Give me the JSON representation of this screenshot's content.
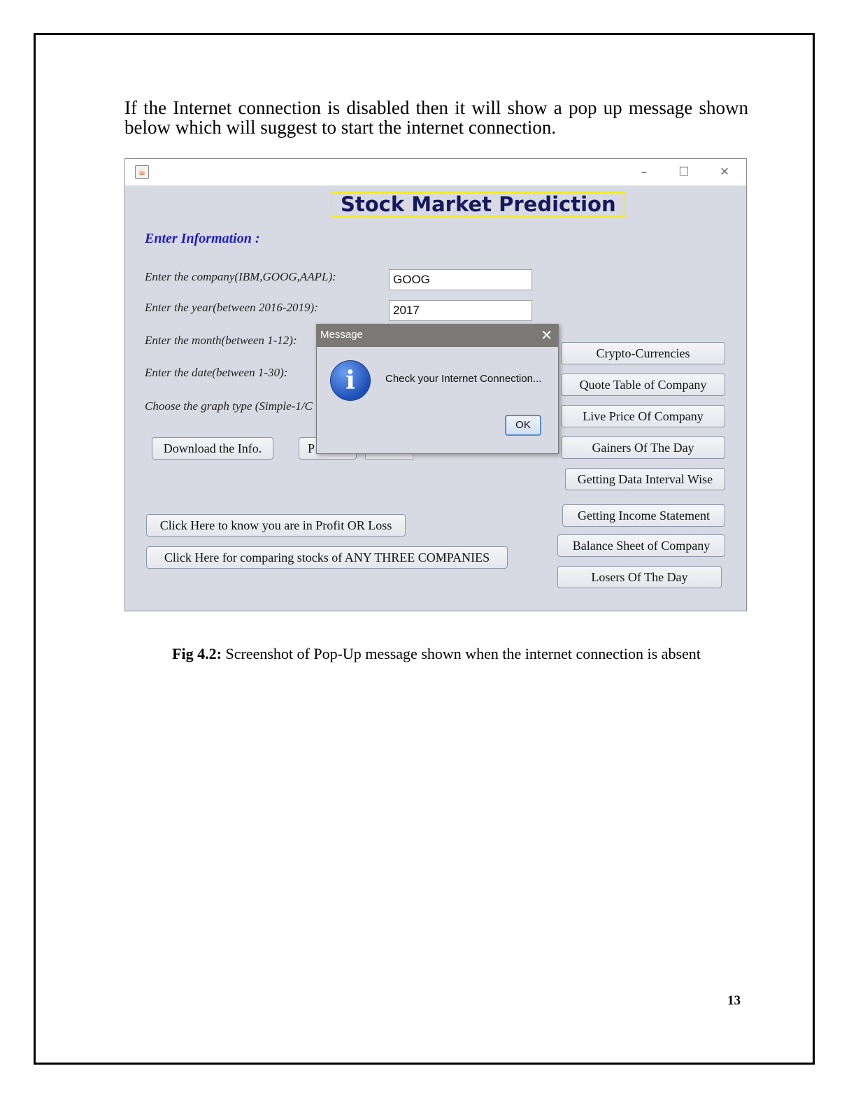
{
  "intro_text": "If the Internet connection is disabled then it will show a pop up message shown below which will suggest to start the internet connection.",
  "caption": {
    "label": "Fig 4.2:",
    "text": " Screenshot of Pop-Up message shown when the internet connection is absent"
  },
  "page_number": "13",
  "window": {
    "minimize": "–",
    "maximize": "☐",
    "close": "✕",
    "app_title": "Stock Market Prediction",
    "section_label": "Enter Information :",
    "fields": {
      "company_label": "Enter the company(IBM,GOOG,AAPL):",
      "company_value": "GOOG",
      "year_label": "Enter the year(between 2016-2019):",
      "year_value": "2017",
      "month_label": "Enter the month(between 1-12):",
      "date_label": "Enter the date(between 1-30):",
      "graph_label": "Choose the graph type (Simple-1/C"
    },
    "buttons": {
      "download": "Download the Info.",
      "partial": "P",
      "profit_loss": "Click Here to know you are in Profit OR Loss",
      "compare": "Click Here for comparing stocks of ANY THREE COMPANIES",
      "crypto": "Crypto-Currencies",
      "quote_table": "Quote Table of Company",
      "live_price": "Live Price Of Company",
      "gainers": "Gainers Of The Day",
      "interval": "Getting Data Interval Wise",
      "income": "Getting Income Statement",
      "balance": "Balance Sheet of Company",
      "losers": "Losers Of The Day"
    }
  },
  "dialog": {
    "title": "Message",
    "close": "✕",
    "icon": "i",
    "message": "Check your Internet Connection...",
    "ok": "OK"
  },
  "colors": {
    "app_title_border": "#f2ea2a",
    "section_label": "#1c1cb8",
    "window_bg": "#d7dae2",
    "dialog_bar": "#7d7878"
  }
}
